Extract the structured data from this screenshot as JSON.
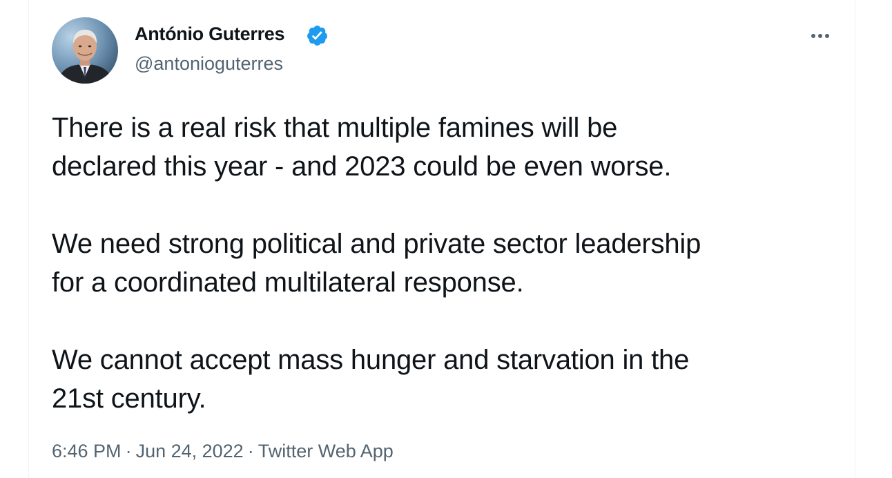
{
  "author": {
    "display_name": "António Guterres",
    "handle": "@antonioguterres",
    "verified": true,
    "avatar_icon": "profile-photo"
  },
  "menu": {
    "more_icon": "more-horizontal-icon"
  },
  "tweet": {
    "paragraphs": [
      "There is a real risk that multiple famines will be\ndeclared this year - and 2023 could be even worse.",
      "We need strong political and private sector leadership\nfor a coordinated multilateral response.",
      "We cannot accept mass hunger and starvation in the\n21st century."
    ]
  },
  "meta": {
    "time": "6:46 PM",
    "separator": "·",
    "date": "Jun 24, 2022",
    "source": "Twitter Web App"
  },
  "colors": {
    "text_primary": "#0f1419",
    "text_secondary": "#536471",
    "verified_blue": "#1d9bf0"
  }
}
